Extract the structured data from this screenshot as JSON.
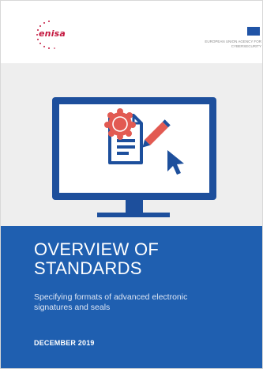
{
  "header": {
    "logo_text": "enisa",
    "agency_name": "EUROPEAN UNION AGENCY FOR CYBERSECURITY"
  },
  "cover": {
    "title": "OVERVIEW OF STANDARDS",
    "subtitle": "Specifying formats of advanced electronic signatures and seals",
    "date": "DECEMBER 2019"
  },
  "colors": {
    "brand_blue": "#1f5fb0",
    "monitor_blue": "#1d4f9c",
    "seal_red": "#e25a52",
    "logo_red": "#c4183f",
    "art_background": "#eeeeee"
  },
  "icons": [
    "monitor-icon",
    "document-icon",
    "seal-icon",
    "pencil-icon",
    "cursor-icon"
  ]
}
